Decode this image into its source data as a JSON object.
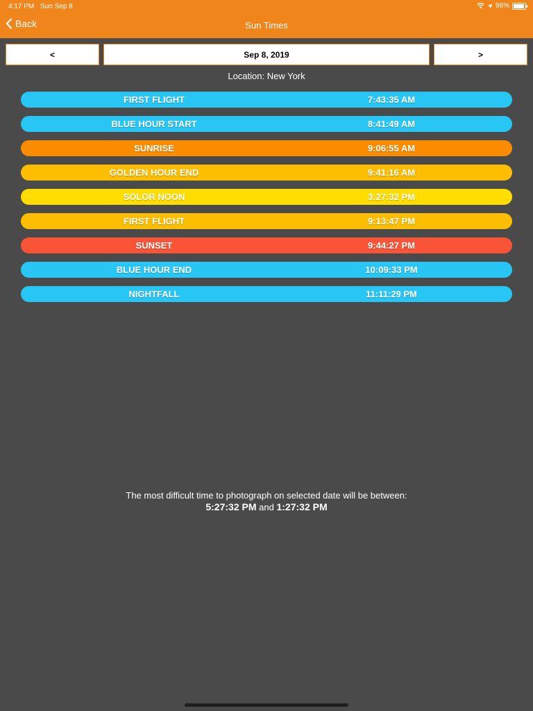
{
  "status_bar": {
    "time": "4:17 PM",
    "date": "Sun Sep 8",
    "battery": "96%",
    "battery_level": 0.96
  },
  "nav": {
    "back_label": "Back",
    "title": "Sun Times"
  },
  "date_nav": {
    "prev_label": "<",
    "current_date": "Sep 8, 2019",
    "next_label": ">"
  },
  "location": "Location: New York",
  "times": [
    {
      "label": "FIRST FLIGHT",
      "time": "7:43:35 AM",
      "color": "#27c6f5"
    },
    {
      "label": "BLUE HOUR START",
      "time": "8:41:49 AM",
      "color": "#27c6f5"
    },
    {
      "label": "SUNRISE",
      "time": "9:06:55 AM",
      "color": "#fb8c00"
    },
    {
      "label": "GOLDEN HOUR END",
      "time": "9:41:16 AM",
      "color": "#fdbd00"
    },
    {
      "label": "SOLOR NOON",
      "time": "3:27:32 PM",
      "color": "#ffdd00"
    },
    {
      "label": "FIRST FLIGHT",
      "time": "9:13:47 PM",
      "color": "#fdbd00"
    },
    {
      "label": "SUNSET",
      "time": "9:44:27 PM",
      "color": "#f95438"
    },
    {
      "label": "BLUE HOUR END",
      "time": "10:09:33 PM",
      "color": "#27c6f5"
    },
    {
      "label": "NIGHTFALL",
      "time": "11:11:29 PM",
      "color": "#27c6f5"
    }
  ],
  "bottom": {
    "message": "The most difficult time to photograph on selected date will be between:",
    "start_time": "5:27:32 PM",
    "and": "and",
    "end_time": "1:27:32 PM"
  },
  "colors": {
    "accent": "#f0861b",
    "background": "#4a4a4a"
  }
}
